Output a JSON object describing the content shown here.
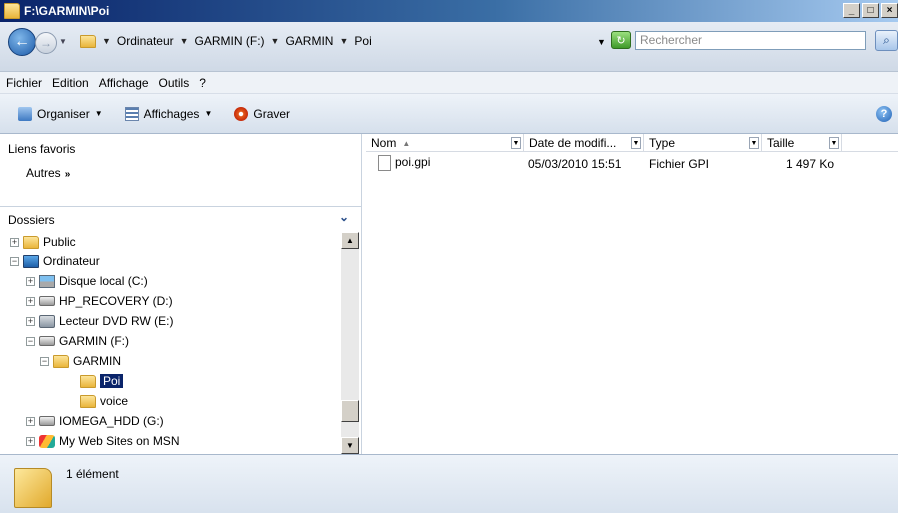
{
  "window": {
    "title": "F:\\GARMIN\\Poi"
  },
  "address": {
    "crumbs": [
      "Ordinateur",
      "GARMIN (F:)",
      "GARMIN",
      "Poi"
    ],
    "search_placeholder": "Rechercher"
  },
  "menu": [
    "Fichier",
    "Edition",
    "Affichage",
    "Outils",
    "?"
  ],
  "toolbar": {
    "organize": "Organiser",
    "views": "Affichages",
    "burn": "Graver"
  },
  "favorites": {
    "title": "Liens favoris",
    "more": "Autres"
  },
  "folders": {
    "title": "Dossiers",
    "items": [
      {
        "label": "Public",
        "icon": "folder-icon"
      },
      {
        "label": "Ordinateur",
        "icon": "computer-icon"
      },
      {
        "label": "Disque local (C:)",
        "icon": "local-disk-icon"
      },
      {
        "label": "HP_RECOVERY (D:)",
        "icon": "drive-icon"
      },
      {
        "label": "Lecteur DVD RW (E:)",
        "icon": "dvd-drive-icon"
      },
      {
        "label": "GARMIN (F:)",
        "icon": "drive-icon"
      },
      {
        "label": "GARMIN",
        "icon": "folder-icon"
      },
      {
        "label": "Poi",
        "icon": "folder-icon",
        "selected": true
      },
      {
        "label": "voice",
        "icon": "folder-icon"
      },
      {
        "label": "IOMEGA_HDD (G:)",
        "icon": "drive-icon"
      },
      {
        "label": "My Web Sites on MSN",
        "icon": "web-sites-icon"
      }
    ]
  },
  "columns": [
    "Nom",
    "Date de modifi...",
    "Type",
    "Taille"
  ],
  "files": [
    {
      "name": "poi.gpi",
      "modified": "05/03/2010 15:51",
      "type": "Fichier GPI",
      "size": "1 497 Ko"
    }
  ],
  "status": {
    "count": "1 élément"
  }
}
